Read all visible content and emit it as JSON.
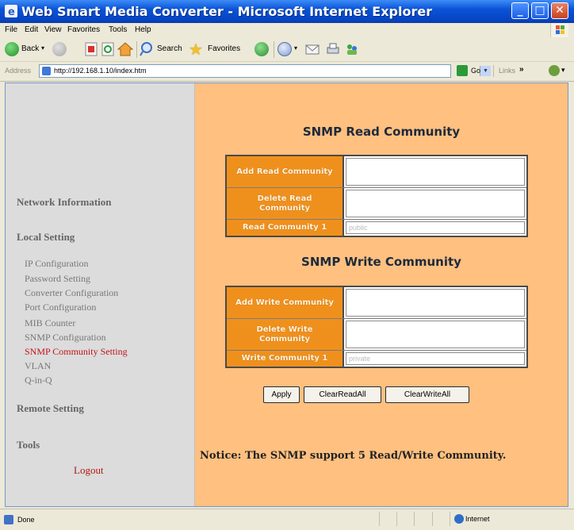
{
  "window": {
    "title": "Web Smart Media Converter - Microsoft Internet Explorer",
    "buttons": {
      "minimize": "_",
      "maximize": "□",
      "close": "✕"
    }
  },
  "menu": [
    "File",
    "Edit",
    "View",
    "Favorites",
    "Tools",
    "Help"
  ],
  "toolbar": {
    "back": "Back",
    "search": "Search",
    "favorites": "Favorites"
  },
  "address": {
    "label": "Address",
    "url": "http://192.168.1.10/index.htm",
    "go": "Go",
    "links": "Links",
    "links_chevron": "»"
  },
  "sidebar": {
    "network_information": "Network Information",
    "local_setting": "Local Setting",
    "items": [
      "IP Configuration",
      "Password Setting",
      "Converter Configuration",
      "Port Configuration",
      "MIB Counter",
      "SNMP Configuration",
      "SNMP Community Setting",
      "VLAN",
      "Q-in-Q"
    ],
    "active_item": "SNMP Community Setting",
    "remote_setting": "Remote Setting",
    "tools": "Tools",
    "logout": "Logout"
  },
  "read_section": {
    "title": "SNMP Read Community",
    "rows": [
      {
        "label": "Add Read Community",
        "value": ""
      },
      {
        "label": "Delete Read Community",
        "value": ""
      },
      {
        "label": "Read Community 1",
        "value": "public"
      }
    ]
  },
  "write_section": {
    "title": "SNMP Write Community",
    "rows": [
      {
        "label": "Add Write Community",
        "value": ""
      },
      {
        "label": "Delete Write Community",
        "value": ""
      },
      {
        "label": "Write Community 1",
        "value": "private"
      }
    ]
  },
  "buttons": {
    "apply": "Apply",
    "clear_read": "ClearReadAll",
    "clear_write": "ClearWriteAll"
  },
  "notice": "Notice: The SNMP support 5 Read/Write Community.",
  "status": {
    "text": "Done",
    "zone": "Internet"
  },
  "colors": {
    "sidebar_bg": "#dcdcdc",
    "main_bg": "#ffc080",
    "label_cell": "#f0901c",
    "active_link": "#c1131a",
    "titlebar": "#0a53d8"
  }
}
